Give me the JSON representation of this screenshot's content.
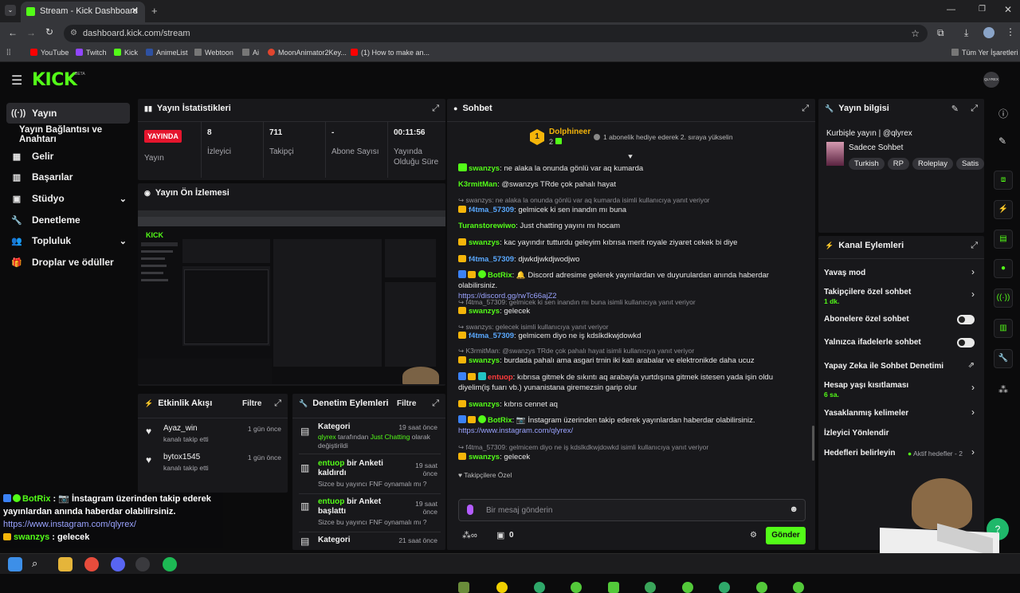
{
  "browser": {
    "tab_title": "Stream - Kick Dashboard",
    "url": "dashboard.kick.com/stream",
    "bookmarks": [
      "YouTube",
      "Twitch",
      "Kick",
      "AnimeList",
      "Webtoon",
      "Ai",
      "MoonAnimator2Key...",
      "(1) How to make an...",
      "Tüm Yer İşaretleri"
    ]
  },
  "header": {
    "logo": "KICK",
    "beta": "BETA",
    "avatar": "QLYREX"
  },
  "sidebar": {
    "items": [
      {
        "label": "Yayın",
        "icon": "stream-icon"
      },
      {
        "label": "Yayın Bağlantısı ve Anahtarı"
      },
      {
        "label": "Gelir",
        "icon": "revenue-icon"
      },
      {
        "label": "Başarılar",
        "icon": "achievements-icon"
      },
      {
        "label": "Stüdyo",
        "icon": "studio-icon"
      },
      {
        "label": "Denetleme",
        "icon": "wrench-icon"
      },
      {
        "label": "Topluluk",
        "icon": "community-icon"
      },
      {
        "label": "Droplar ve ödüller",
        "icon": "gift-icon"
      }
    ]
  },
  "stats": {
    "title": "Yayın İstatistikleri",
    "live": "YAYINDA",
    "status": "Yayın",
    "cols": [
      {
        "value": "8",
        "label": "İzleyici"
      },
      {
        "value": "711",
        "label": "Takipçi"
      },
      {
        "value": "-",
        "label": "Abone Sayısı"
      },
      {
        "value": "00:11:56",
        "label": "Yayında Olduğu Süre"
      }
    ]
  },
  "preview": {
    "title": "Yayın Ön İzlemesi"
  },
  "activity": {
    "title": "Etkinlik Akışı",
    "filter": "Filtre",
    "items": [
      {
        "user": "Ayaz_win",
        "sub": "kanalı takip etti",
        "time": "1 gün önce"
      },
      {
        "user": "bytox1545",
        "sub": "kanalı takip etti",
        "time": "1 gün önce"
      }
    ]
  },
  "moderation": {
    "title": "Denetim Eylemleri",
    "filter": "Filtre",
    "items": [
      {
        "title": "Kategori",
        "desc_user": "qlyrex",
        "desc_mid": " tarafından ",
        "desc_cat": "Just Chatting",
        "desc_end": " olarak değiştirildi",
        "time": "19 saat önce"
      },
      {
        "title_user": "entuop",
        "title_rest": " bir Anketi kaldırdı",
        "sub": "Sizce bu yayıncı FNF oynamalı mı ?",
        "time": "19 saat önce"
      },
      {
        "title_user": "entuop",
        "title_rest": " bir Anket başlattı",
        "sub": "Sizce bu yayıncı FNF oynamalı mı ?",
        "time": "19 saat önce"
      },
      {
        "title": "Kategori",
        "time": "21 saat önce"
      }
    ]
  },
  "chat": {
    "title": "Sohbet",
    "pinned_user": "Dolphineer",
    "pinned_rank": "1",
    "pinned_count": "2",
    "pinned_text": "1 abonelik hediye ederek 2. sıraya yükselin",
    "messages": [
      {
        "user": "swanzys",
        "color": "#53fc18",
        "text": ": ne alaka la onunda gönlü var aq kumarda"
      },
      {
        "user": "K3rmitMan",
        "color": "#53fc18",
        "text": ": @swanzys TRde çok pahalı hayat"
      },
      {
        "reply": "swanzys: ne alaka la onunda gönlü var aq kumarda isimli kullanıcıya yanıt veriyor"
      },
      {
        "user": "f4tma_57309",
        "color": "#5aa9ff",
        "text": ": gelmicek ki sen inandın mı buna"
      },
      {
        "user": "Turanstorewiwo",
        "color": "#53fc18",
        "text": ": Just chatting yayını mı hocam"
      },
      {
        "user": "swanzys",
        "color": "#53fc18",
        "text": ": kac yayındır tutturdu geleyim kıbrısa merit royale ziyaret cekek bi diye"
      },
      {
        "user": "f4tma_57309",
        "color": "#5aa9ff",
        "text": ": djwkdjwkdjwodjwo"
      },
      {
        "user": "BotRix",
        "color": "#53fc18",
        "text": ": 🔔 Discord adresime gelerek yayınlardan ve duyurulardan anında haberdar olabilirsiniz.",
        "link": "https://discord.gg/rwTc66ajZ2"
      },
      {
        "reply": "f4tma_57309: gelmicek ki sen inandın mı buna isimli kullanıcıya yanıt veriyor"
      },
      {
        "user": "swanzys",
        "color": "#53fc18",
        "text": ": gelecek"
      },
      {
        "reply": "swanzys: gelecek isimli kullanıcıya yanıt veriyor"
      },
      {
        "user": "f4tma_57309",
        "color": "#5aa9ff",
        "text": ": gelmicem diyo ne iş kdslkdkwjdowkd"
      },
      {
        "reply": "K3rmitMan: @swanzys TRde çok pahalı hayat isimli kullanıcıya yanıt veriyor"
      },
      {
        "user": "swanzys",
        "color": "#53fc18",
        "text": ": burdada pahalı ama asgari trnin iki katı arabalar ve elektronikde daha ucuz"
      },
      {
        "user": "entuop",
        "color": "#ff3b3b",
        "text": ": kıbrısa gitmek de sıkıntı aq arabayla yurtdışına gitmek istesen yada işin oldu diyelim(iş fuarı vb.) yunanistana giremezsin garip olur"
      },
      {
        "user": "swanzys",
        "color": "#53fc18",
        "text": ": kıbrıs cennet aq"
      },
      {
        "user": "BotRix",
        "color": "#53fc18",
        "text": ": 📷 İnstagram üzerinden takip ederek yayınlardan haberdar olabilirsiniz.",
        "link": "https://www.instagram.com/qlyrex/"
      },
      {
        "reply": "f4tma_57309: gelmicem diyo ne iş kdslkdkwjdowkd isimli kullanıcıya yanıt veriyor"
      },
      {
        "user": "swanzys",
        "color": "#53fc18",
        "text": ": gelecek"
      }
    ],
    "followers_only": "Takipçilere Özel",
    "input_placeholder": "Bir mesaj gönderin",
    "points": "0",
    "send": "Gönder"
  },
  "info": {
    "title": "Yayın bilgisi",
    "stream_title": "Kurbişle yayın | @qlyrex",
    "category": "Sadece Sohbet",
    "tags": [
      "Turkish",
      "RP",
      "Roleplay",
      "Satis"
    ]
  },
  "actions": {
    "title": "Kanal Eylemleri",
    "rows": [
      {
        "label": "Yavaş mod",
        "type": "chevron"
      },
      {
        "label": "Takipçilere özel sohbet",
        "sub": "1 dk.",
        "type": "chevron"
      },
      {
        "label": "Abonelere özel sohbet",
        "type": "toggle"
      },
      {
        "label": "Yalnızca ifadelerle sohbet",
        "type": "toggle"
      },
      {
        "label": "Yapay Zeka ile Sohbet Denetimi",
        "type": "external"
      },
      {
        "label": "Hesap yaşı kısıtlaması",
        "sub": "6 sa.",
        "type": "chevron"
      },
      {
        "label": "Yasaklanmış kelimeler",
        "type": "chevron"
      },
      {
        "label": "İzleyici Yönlendir",
        "type": "none"
      },
      {
        "label": "Hedefleri belirleyin",
        "sub2": "Aktif hedefler - 2",
        "type": "chevron"
      }
    ]
  },
  "overlay": {
    "lines": [
      {
        "user": "BotRix",
        "text": " : 📷 İnstagram üzerinden takip ederek yayınlardan anında haberdar olabilirsiniz."
      },
      {
        "link": "https://www.instagram.com/qlyrex/"
      },
      {
        "user": "swanzys",
        "text": " : gelecek"
      }
    ]
  },
  "colors": {
    "brand": "#53fc18",
    "panel": "#18181b",
    "live": "#e5152d"
  }
}
